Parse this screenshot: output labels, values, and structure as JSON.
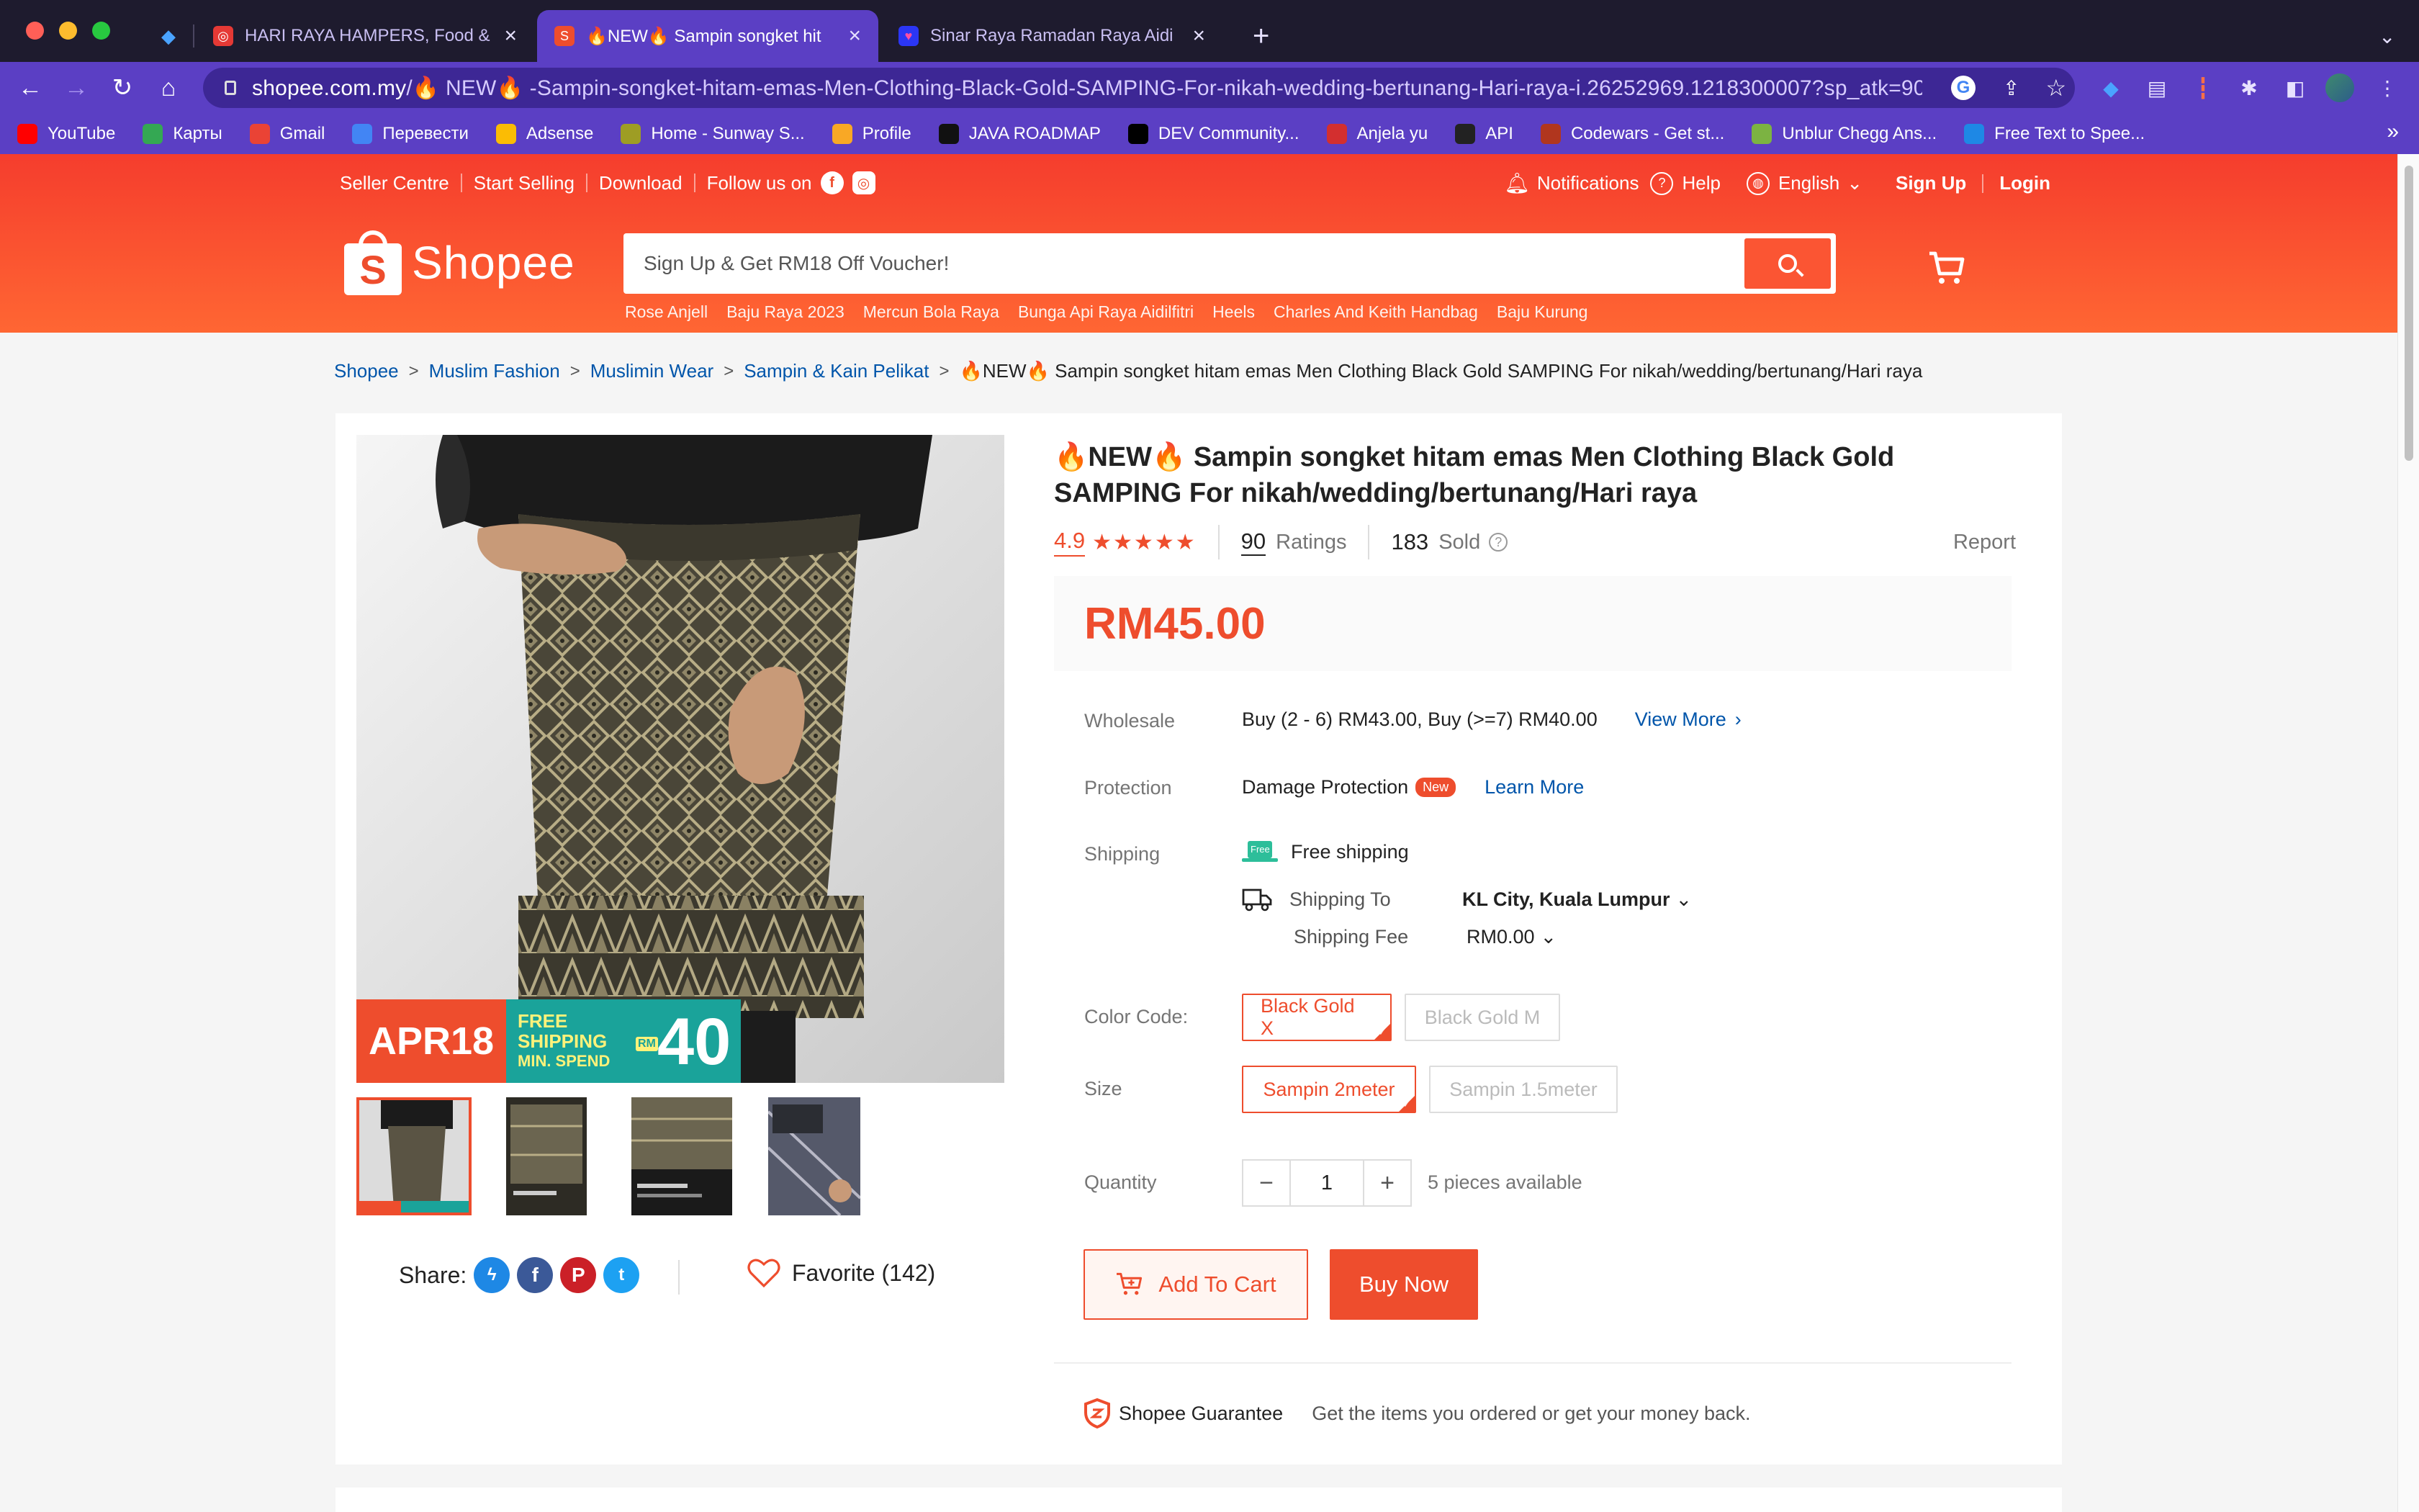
{
  "browser": {
    "tabs": [
      {
        "label": "",
        "icon": "gem-icon",
        "icon_color": "#3b82f6"
      },
      {
        "label": "HARI RAYA HAMPERS, Food &",
        "icon": "site-icon",
        "icon_color": "#e53935"
      },
      {
        "label": "🔥NEW🔥 Sampin songket hit",
        "icon": "shopee-icon",
        "icon_color": "#ee4d2d",
        "active": true
      },
      {
        "label": "Sinar Raya Ramadan Raya Aidi",
        "icon": "lazada-icon",
        "icon_color": "#2b36f5"
      }
    ],
    "address": {
      "host": "shopee.com.my",
      "path": "/🔥 NEW🔥 -Sampin-songket-hitam-emas-Men-Clothing-Black-Gold-SAMPING-For-nikah-wedding-bertunang-Hari-raya-i.26252969.1218300007?sp_atk=903..."
    },
    "bookmarks": [
      {
        "label": "YouTube",
        "color": "#ff0000"
      },
      {
        "label": "Карты",
        "color": "#34a853"
      },
      {
        "label": "Gmail",
        "color": "#ea4335"
      },
      {
        "label": "Перевести",
        "color": "#4285f4"
      },
      {
        "label": "Adsense",
        "color": "#fbbc04"
      },
      {
        "label": "Home - Sunway S...",
        "color": "#9e9d24"
      },
      {
        "label": "Profile",
        "color": "#f9a825"
      },
      {
        "label": "JAVA ROADMAP",
        "color": "#111111"
      },
      {
        "label": "DEV Community...",
        "color": "#000000"
      },
      {
        "label": "Anjela yu",
        "color": "#d32f2f"
      },
      {
        "label": "API",
        "color": "#222222"
      },
      {
        "label": "Codewars - Get st...",
        "color": "#b1361e"
      },
      {
        "label": "Unblur Chegg Ans...",
        "color": "#7cb342"
      },
      {
        "label": "Free Text to Spee...",
        "color": "#1e88e5"
      }
    ],
    "bookmarks_more": "»"
  },
  "header": {
    "links": [
      "Seller Centre",
      "Start Selling",
      "Download"
    ],
    "follow_label": "Follow us on",
    "notifications": "Notifications",
    "help": "Help",
    "language": "English",
    "sign_up": "Sign Up",
    "login": "Login",
    "logo_text": "Shopee",
    "logo_letter": "S",
    "search_placeholder": "Sign Up & Get RM18 Off Voucher!",
    "search_hints": [
      "Rose Anjell",
      "Baju Raya 2023",
      "Mercun Bola Raya",
      "Bunga Api Raya Aidilfitri",
      "Heels",
      "Charles And Keith Handbag",
      "Baju Kurung"
    ]
  },
  "breadcrumb": {
    "items": [
      "Shopee",
      "Muslim Fashion",
      "Muslimin Wear",
      "Sampin & Kain Pelikat"
    ],
    "current": "🔥NEW🔥 Sampin songket hitam emas Men Clothing Black Gold SAMPING For nikah/wedding/bertunang/Hari raya"
  },
  "product": {
    "title": "🔥NEW🔥 Sampin songket hitam emas Men Clothing Black Gold SAMPING For nikah/wedding/bertunang/Hari raya",
    "rating": "4.9",
    "rating_stars": 4.9,
    "ratings_count": "90",
    "ratings_label": "Ratings",
    "sold_count": "183",
    "sold_label": "Sold",
    "report": "Report",
    "price": "RM45.00",
    "banner": {
      "date": "APR18",
      "line1": "FREE",
      "line2": "SHIPPING",
      "line3": "MIN. SPEND",
      "currency": "RM",
      "amount": "40"
    },
    "wholesale": {
      "label": "Wholesale",
      "value": "Buy (2 - 6) RM43.00, Buy (>=7) RM40.00",
      "link": "View More"
    },
    "protection": {
      "label": "Protection",
      "value": "Damage Protection",
      "badge": "New",
      "link": "Learn More"
    },
    "shipping": {
      "label": "Shipping",
      "free_badge": "Free",
      "free_text": "Free shipping",
      "to_label": "Shipping To",
      "to_value": "KL City, Kuala Lumpur",
      "fee_label": "Shipping Fee",
      "fee_value": "RM0.00"
    },
    "color": {
      "label": "Color Code:",
      "options": [
        "Black Gold X",
        "Black Gold M"
      ],
      "selected": "Black Gold X"
    },
    "size": {
      "label": "Size",
      "options": [
        "Sampin 2meter",
        "Sampin 1.5meter"
      ],
      "selected": "Sampin 2meter"
    },
    "quantity": {
      "label": "Quantity",
      "value": "1",
      "minus": "−",
      "plus": "+",
      "available": "5 pieces available"
    },
    "add_to_cart": "Add To Cart",
    "buy_now": "Buy Now",
    "guarantee": {
      "title": "Shopee Guarantee",
      "text": "Get the items you ordered or get your money back."
    },
    "share_label": "Share:",
    "favorite": "Favorite (142)"
  },
  "colors": {
    "brand": "#ee4d2d",
    "browser_accent": "#5b3fc4"
  }
}
